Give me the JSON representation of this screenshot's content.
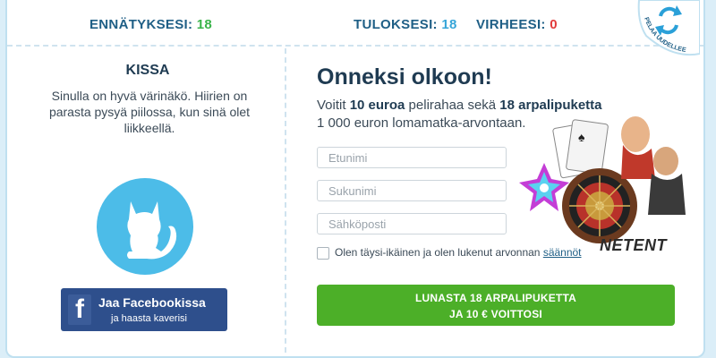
{
  "stats": {
    "record_label": "ENNÄTYKSESI:",
    "record_value": "18",
    "score_label": "TULOKSESI:",
    "score_value": "18",
    "errors_label": "VIRHEESI:",
    "errors_value": "0"
  },
  "replay": {
    "label": "PELAA UUDELLEEN",
    "icon": "refresh-icon"
  },
  "result": {
    "title": "KISSA",
    "description": "Sinulla on hyvä värinäkö. Hiirien on parasta pysyä piilossa, kun sinä olet liikkeellä.",
    "icon": "cat-icon"
  },
  "facebook": {
    "icon_letter": "f",
    "line1": "Jaa Facebookissa",
    "line2": "ja haasta kaverisi"
  },
  "offer": {
    "headline": "Onneksi olkoon!",
    "text_1": "Voitit ",
    "amount": "10 euroa",
    "text_2": " pelirahaa sekä ",
    "tickets": "18 arpalipuketta",
    "text_3": "1 000 euron lomamatka-arvontaan."
  },
  "form": {
    "firstname_placeholder": "Etunimi",
    "lastname_placeholder": "Sukunimi",
    "email_placeholder": "Sähköposti",
    "consent_text": "Olen täysi-ikäinen ja olen lukenut arvonnan ",
    "consent_link": "säännöt"
  },
  "cta": {
    "line1": "LUNASTA 18 ARPALIPUKETTA",
    "line2": "JA 10 € VOITTOSI"
  },
  "promo": {
    "brand": "NETENT"
  },
  "colors": {
    "accent_blue": "#4cbce8",
    "green": "#4caf28",
    "facebook": "#2e4f8c",
    "dark_blue": "#1f5f86"
  }
}
